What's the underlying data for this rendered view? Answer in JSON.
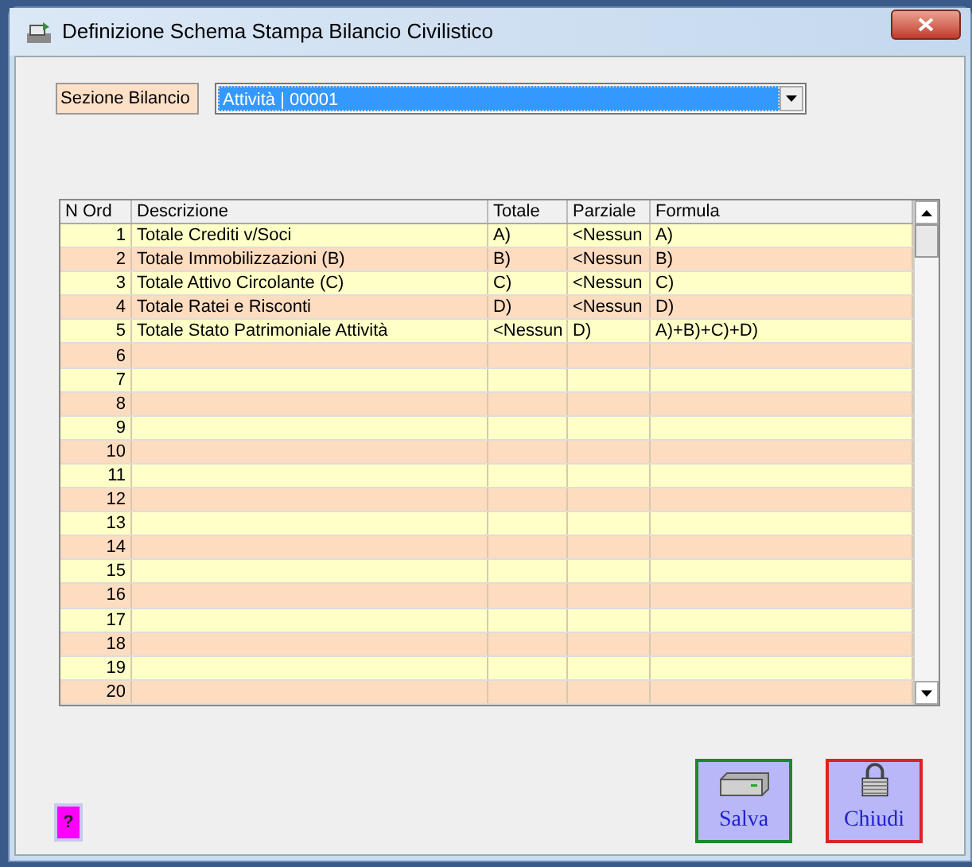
{
  "window": {
    "title": "Definizione Schema Stampa Bilancio Civilistico"
  },
  "section": {
    "label": "Sezione Bilancio",
    "value": "Attività | 00001"
  },
  "grid": {
    "columns": [
      "N Ord",
      "Descrizione",
      "Totale",
      "Parziale",
      "Formula"
    ],
    "rows": [
      {
        "n": "1",
        "descrizione": "Totale Crediti v/Soci",
        "totale": "A)",
        "parziale": "<Nessun",
        "formula": "A)"
      },
      {
        "n": "2",
        "descrizione": "Totale Immobilizzazioni (B)",
        "totale": "B)",
        "parziale": "<Nessun",
        "formula": "B)"
      },
      {
        "n": "3",
        "descrizione": "Totale Attivo Circolante (C)",
        "totale": "C)",
        "parziale": "<Nessun",
        "formula": "C)"
      },
      {
        "n": "4",
        "descrizione": "Totale Ratei e Risconti",
        "totale": "D)",
        "parziale": "<Nessun",
        "formula": "D)"
      },
      {
        "n": "5",
        "descrizione": "Totale Stato Patrimoniale Attività",
        "totale": "<Nessun",
        "parziale": "D)",
        "formula": "A)+B)+C)+D)"
      },
      {
        "n": "6"
      },
      {
        "n": "7"
      },
      {
        "n": "8"
      },
      {
        "n": "9"
      },
      {
        "n": "10"
      },
      {
        "n": "11"
      },
      {
        "n": "12"
      },
      {
        "n": "13"
      },
      {
        "n": "14"
      },
      {
        "n": "15"
      },
      {
        "n": "16"
      },
      {
        "n": "17"
      },
      {
        "n": "18"
      },
      {
        "n": "19"
      },
      {
        "n": "20"
      }
    ]
  },
  "help_button": {
    "label": "?"
  },
  "buttons": [
    {
      "kind": "save",
      "label": "Salva"
    },
    {
      "kind": "close",
      "label": "Chiudi"
    }
  ]
}
